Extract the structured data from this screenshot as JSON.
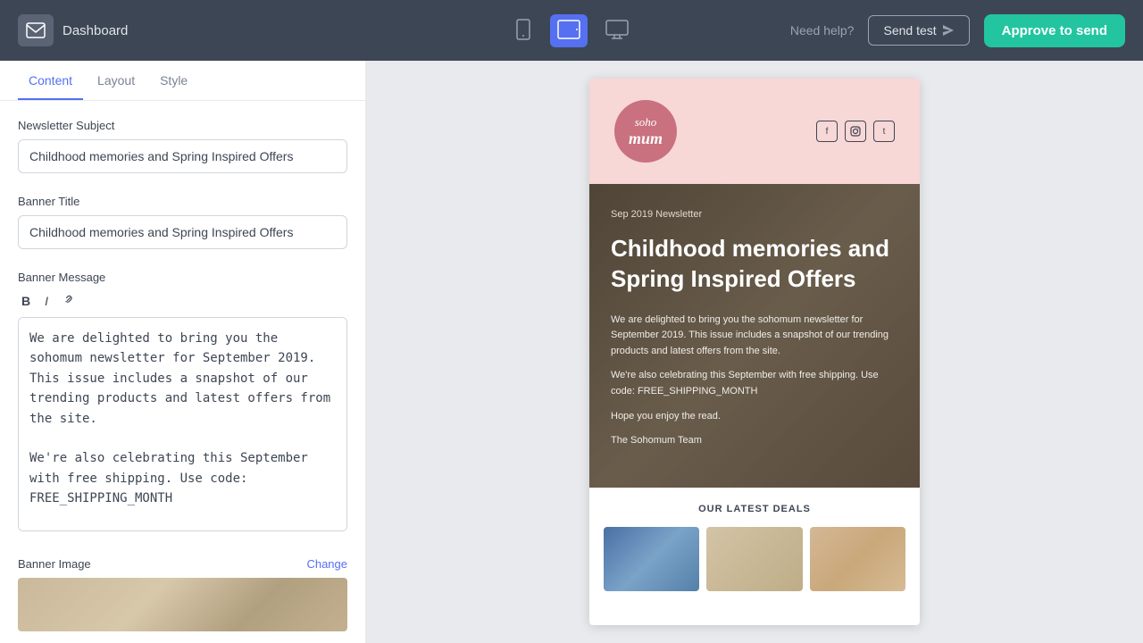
{
  "topnav": {
    "logo_label": "Dashboard",
    "need_help": "Need help?",
    "send_test_label": "Send test",
    "approve_label": "Approve to send"
  },
  "tabs": {
    "content": "Content",
    "layout": "Layout",
    "style": "Style"
  },
  "left_panel": {
    "newsletter_subject_label": "Newsletter Subject",
    "newsletter_subject_value": "Childhood memories and Spring Inspired Offers",
    "banner_title_label": "Banner Title",
    "banner_title_value": "Childhood memories and Spring Inspired Offers",
    "banner_message_label": "Banner Message",
    "banner_message_value": "We are delighted to bring you the sohomum newsletter for September 2019. This issue includes a snapshot of our trending products and latest offers from the site.\n\nWe're also celebrating this September with free shipping. Use code: FREE_SHIPPING_MONTH\n\nHope you enjoy the read.\n\nThe Sohomum Team",
    "banner_image_label": "Banner Image",
    "change_label": "Change"
  },
  "email_preview": {
    "newsletter_label": "Sep 2019 Newsletter",
    "title": "Childhood memories and Spring Inspired Offers",
    "body_line1": "We are delighted to bring you the sohomum newsletter for September 2019. This issue includes a snapshot of our trending products and latest offers from the site.",
    "body_line2": "We're also celebrating this September with free shipping. Use code: FREE_SHIPPING_MONTH",
    "body_line3": "Hope you enjoy the read.",
    "body_line4": "The Sohomum Team",
    "deals_title": "OUR LATEST DEALS",
    "logo_top": "soho",
    "logo_bottom": "mum"
  }
}
